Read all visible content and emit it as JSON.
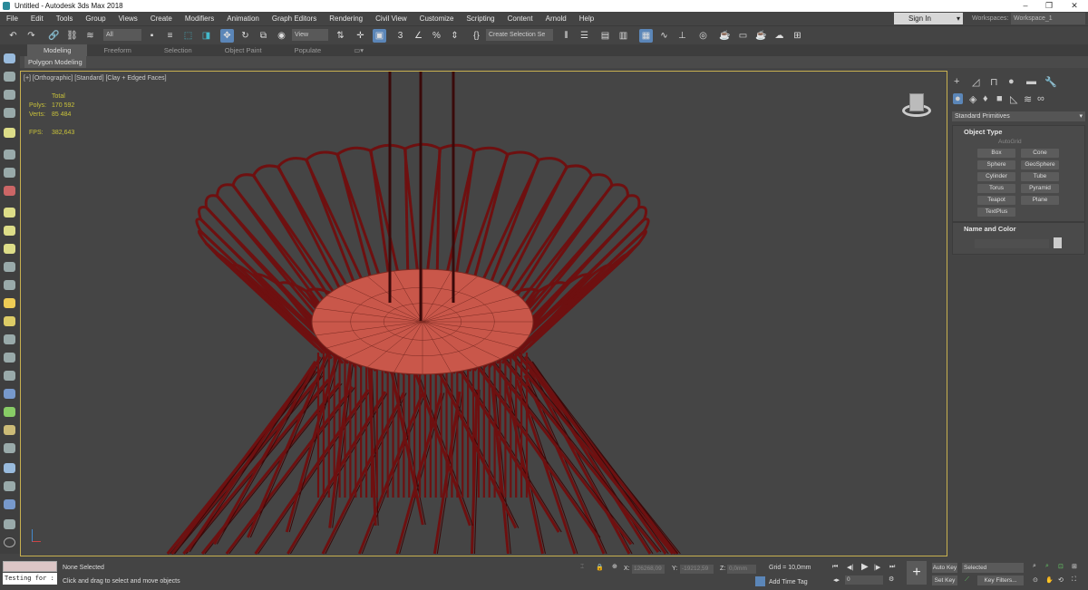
{
  "window": {
    "title": "Untitled - Autodesk 3ds Max 2018",
    "minimize": "–",
    "maximize": "❐",
    "close": "✕"
  },
  "menu": [
    "File",
    "Edit",
    "Tools",
    "Group",
    "Views",
    "Create",
    "Modifiers",
    "Animation",
    "Graph Editors",
    "Rendering",
    "Civil View",
    "Customize",
    "Scripting",
    "Content",
    "Arnold",
    "Help"
  ],
  "account": {
    "sign_in": "Sign In",
    "workspaces_label": "Workspaces:",
    "workspace": "Workspace_1"
  },
  "toolbar": {
    "selection_filter": "All",
    "reference_coord": "View",
    "named_selection": "Create Selection Se",
    "snap_label": "3"
  },
  "ribbon": {
    "tabs": [
      "Modeling",
      "Freeform",
      "Selection",
      "Object Paint",
      "Populate"
    ],
    "active": "Modeling",
    "panel": "Polygon Modeling"
  },
  "viewport": {
    "label": "[+] [Orthographic] [Standard] [Clay + Edged Faces]",
    "stats": {
      "header": "Total",
      "polys_label": "Polys:",
      "polys": "170 592",
      "verts_label": "Verts:",
      "verts": "85 484",
      "fps_label": "FPS:",
      "fps": "382,643"
    },
    "colors": {
      "wire": "#6e1010",
      "seat": "#c9574a",
      "border": "#c8b050",
      "stats": "#c9c23a"
    }
  },
  "command_panel": {
    "category": "Standard Primitives",
    "object_type": {
      "title": "Object Type",
      "autogrid": "AutoGrid",
      "buttons": [
        "Box",
        "Cone",
        "Sphere",
        "GeoSphere",
        "Cylinder",
        "Tube",
        "Torus",
        "Pyramid",
        "Teapot",
        "Plane",
        "TextPlus"
      ]
    },
    "name_color": {
      "title": "Name and Color"
    }
  },
  "status": {
    "maxscript": "Testing for :",
    "selection": "None Selected",
    "prompt": "Click and drag to select and move objects",
    "x_label": "X:",
    "x": "126268,09",
    "y_label": "Y:",
    "y": "-19212,59",
    "z_label": "Z:",
    "z": "0,0mm",
    "grid": "Grid = 10,0mm",
    "add_time_tag": "Add Time Tag",
    "frame": "0",
    "auto_key": "Auto Key",
    "set_key": "Set Key",
    "key_mode": "Selected",
    "key_filters": "Key Filters..."
  }
}
